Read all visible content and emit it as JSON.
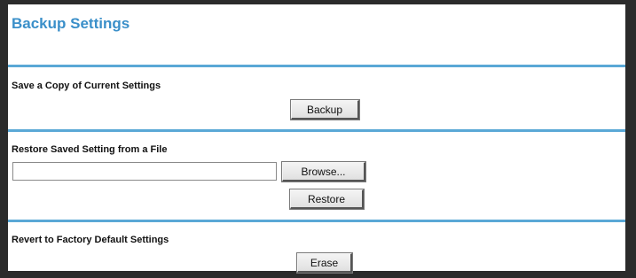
{
  "page": {
    "title": "Backup Settings"
  },
  "backup_section": {
    "label": "Save a Copy of Current Settings",
    "button_label": "Backup"
  },
  "restore_section": {
    "label": "Restore Saved Setting from a File",
    "file_input_value": "",
    "browse_label": "Browse...",
    "restore_label": "Restore"
  },
  "erase_section": {
    "label": "Revert to Factory Default Settings",
    "button_label": "Erase"
  },
  "colors": {
    "title": "#3a8fc9",
    "divider": "#5aa8d6",
    "frame": "#2b2b2b"
  }
}
